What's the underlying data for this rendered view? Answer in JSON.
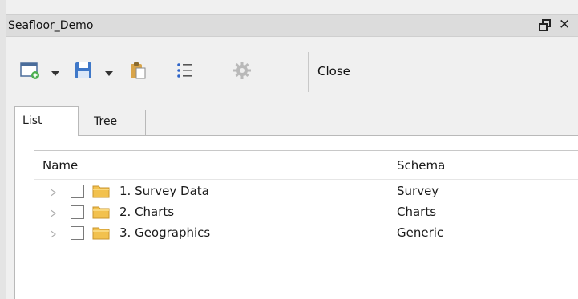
{
  "panel": {
    "title": "Seafloor_Demo",
    "close_glyph": "✕"
  },
  "toolbar": {
    "items": [
      {
        "icon": "new-window-icon",
        "has_dropdown": true
      },
      {
        "icon": "save-icon",
        "has_dropdown": true
      },
      {
        "icon": "paste-clipboard-icon",
        "has_dropdown": false
      },
      {
        "icon": "list-view-icon",
        "has_dropdown": false
      },
      {
        "icon": "settings-gear-icon",
        "has_dropdown": false,
        "disabled": true
      }
    ],
    "close_label": "Close"
  },
  "tabs": [
    {
      "label": "List",
      "active": true
    },
    {
      "label": "Tree",
      "active": false
    }
  ],
  "table": {
    "columns": [
      "Name",
      "Schema"
    ],
    "rows": [
      {
        "name": "1. Survey Data",
        "schema": "Survey",
        "checked": false
      },
      {
        "name": "2. Charts",
        "schema": "Charts",
        "checked": false
      },
      {
        "name": "3. Geographics",
        "schema": "Generic",
        "checked": false
      }
    ]
  },
  "colors": {
    "background": "#f0f0f0",
    "titlebar": "#dcdcdc",
    "folder": "#f2c14e",
    "save_blue": "#3f78c8",
    "new_green": "#4caf50"
  }
}
